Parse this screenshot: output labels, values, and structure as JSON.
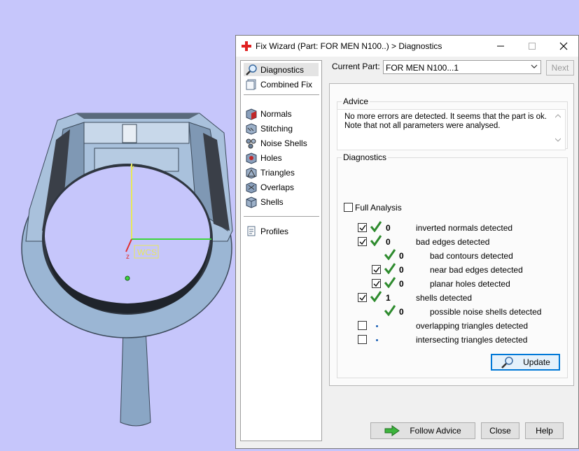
{
  "viewport": {
    "wcs_label": "WCS",
    "axis_z": "z",
    "axis_y": "y"
  },
  "dialog": {
    "title": "Fix Wizard (Part: FOR MEN N100..) > Diagnostics",
    "nav": {
      "items": [
        {
          "label": "Diagnostics",
          "icon": "magnifier-icon"
        },
        {
          "label": "Combined Fix",
          "icon": "combined-fix-icon"
        },
        {
          "label": "Normals",
          "icon": "normals-cube-icon"
        },
        {
          "label": "Stitching",
          "icon": "stitching-cube-icon"
        },
        {
          "label": "Noise Shells",
          "icon": "noise-shells-icon"
        },
        {
          "label": "Holes",
          "icon": "holes-cube-icon"
        },
        {
          "label": "Triangles",
          "icon": "triangles-cube-icon"
        },
        {
          "label": "Overlaps",
          "icon": "overlaps-cube-icon"
        },
        {
          "label": "Shells",
          "icon": "shells-cube-icon"
        },
        {
          "label": "Profiles",
          "icon": "profiles-page-icon"
        }
      ]
    },
    "current_part": {
      "label": "Current Part:",
      "value": "FOR MEN N100...1"
    },
    "next_label": "Next",
    "advice": {
      "title": "Advice",
      "text": "No more errors are detected. It seems that the part is ok. Note that not all parameters were analysed."
    },
    "diagnostics": {
      "title": "Diagnostics",
      "full_analysis_label": "Full Analysis",
      "rows": [
        {
          "value": "0",
          "label": "inverted normals detected"
        },
        {
          "value": "0",
          "label": "bad edges detected"
        },
        {
          "value": "0",
          "label": "bad contours detected"
        },
        {
          "value": "0",
          "label": "near bad edges detected"
        },
        {
          "value": "0",
          "label": "planar holes detected"
        },
        {
          "value": "1",
          "label": "shells detected"
        },
        {
          "value": "0",
          "label": "possible noise shells detected"
        },
        {
          "value": "",
          "label": "overlapping triangles detected"
        },
        {
          "value": "",
          "label": "intersecting triangles detected"
        }
      ],
      "update_label": "Update"
    },
    "buttons": {
      "follow_advice": "Follow Advice",
      "close": "Close",
      "help": "Help"
    },
    "colors": {
      "accent": "#0078d7",
      "check_green": "#2e8b2e",
      "background": "#c6c6fb"
    }
  }
}
